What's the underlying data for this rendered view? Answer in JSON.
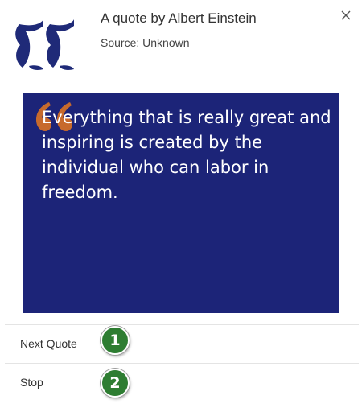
{
  "header": {
    "title": "A quote by Albert Einstein",
    "source": "Source: Unknown",
    "logo_icon": "quote-marks-icon",
    "close_icon": "close-icon",
    "logo_color": "#1f2a78"
  },
  "quote_image": {
    "text": "Everything that is really great and inspiring is created by the individual who can labor in freedom.",
    "background_color": "#1c2478",
    "quote_mark_color": "#c76a2c",
    "text_color": "#ffffff"
  },
  "menu": {
    "items": [
      {
        "label": "Next Quote",
        "badge": "1"
      },
      {
        "label": "Stop",
        "badge": "2"
      }
    ],
    "badge_color": "#2e7d32"
  }
}
